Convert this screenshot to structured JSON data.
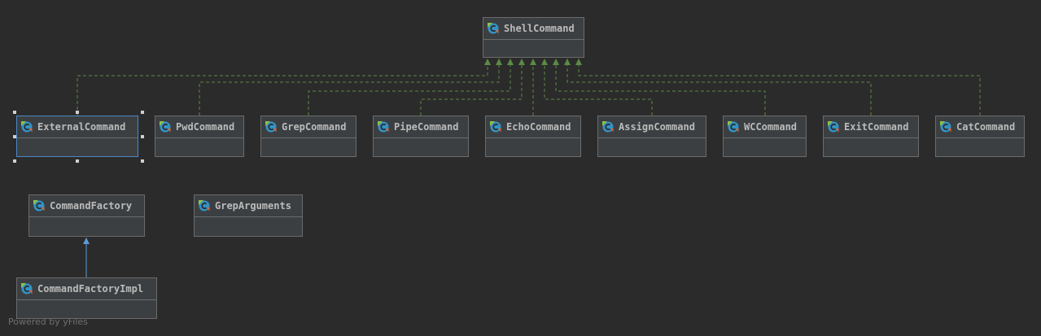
{
  "diagram": {
    "nodes": [
      {
        "id": "ShellCommand",
        "label": "ShellCommand",
        "icon": "class-icon"
      },
      {
        "id": "ExternalCommand",
        "label": "ExternalCommand",
        "icon": "class-icon",
        "selected": true
      },
      {
        "id": "PwdCommand",
        "label": "PwdCommand",
        "icon": "class-icon"
      },
      {
        "id": "GrepCommand",
        "label": "GrepCommand",
        "icon": "class-icon"
      },
      {
        "id": "PipeCommand",
        "label": "PipeCommand",
        "icon": "class-icon"
      },
      {
        "id": "EchoCommand",
        "label": "EchoCommand",
        "icon": "class-icon"
      },
      {
        "id": "AssignCommand",
        "label": "AssignCommand",
        "icon": "class-icon"
      },
      {
        "id": "WCCommand",
        "label": "WCCommand",
        "icon": "class-icon"
      },
      {
        "id": "ExitCommand",
        "label": "ExitCommand",
        "icon": "class-icon"
      },
      {
        "id": "CatCommand",
        "label": "CatCommand",
        "icon": "class-icon"
      },
      {
        "id": "CommandFactory",
        "label": "CommandFactory",
        "icon": "class-icon"
      },
      {
        "id": "GrepArguments",
        "label": "GrepArguments",
        "icon": "class-icon"
      },
      {
        "id": "CommandFactoryImpl",
        "label": "CommandFactoryImpl",
        "icon": "class-icon"
      }
    ],
    "edges": [
      {
        "from": "ExternalCommand",
        "to": "ShellCommand",
        "kind": "implements"
      },
      {
        "from": "PwdCommand",
        "to": "ShellCommand",
        "kind": "implements"
      },
      {
        "from": "GrepCommand",
        "to": "ShellCommand",
        "kind": "implements"
      },
      {
        "from": "PipeCommand",
        "to": "ShellCommand",
        "kind": "implements"
      },
      {
        "from": "EchoCommand",
        "to": "ShellCommand",
        "kind": "implements"
      },
      {
        "from": "AssignCommand",
        "to": "ShellCommand",
        "kind": "implements"
      },
      {
        "from": "WCCommand",
        "to": "ShellCommand",
        "kind": "implements"
      },
      {
        "from": "ExitCommand",
        "to": "ShellCommand",
        "kind": "implements"
      },
      {
        "from": "CatCommand",
        "to": "ShellCommand",
        "kind": "implements"
      },
      {
        "from": "CommandFactoryImpl",
        "to": "CommandFactory",
        "kind": "extends"
      }
    ]
  },
  "colors": {
    "background": "#2b2b2b",
    "node_fill": "#3c3f41",
    "node_border": "#6b6b6b",
    "selection": "#4a88c7",
    "implements_edge": "#5c8a46",
    "extends_edge": "#5b9bd5"
  },
  "footer": {
    "credit": "Powered by yFiles"
  }
}
